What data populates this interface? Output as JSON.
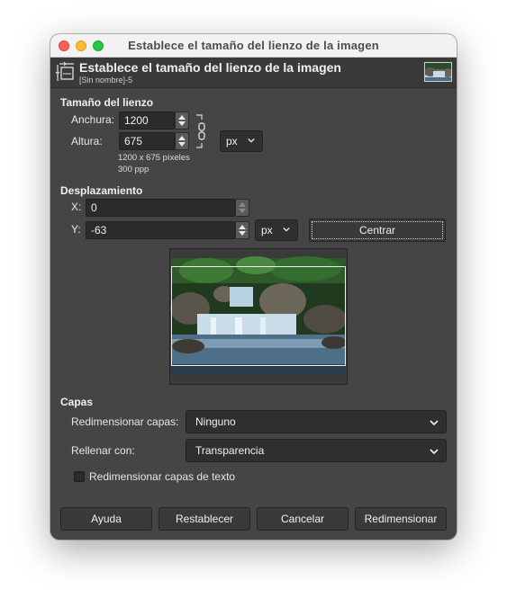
{
  "window": {
    "title": "Establece el tamaño del lienzo de la imagen"
  },
  "header": {
    "title": "Establece el tamaño del lienzo de la imagen",
    "subtitle": "[Sin nombre]-5",
    "icon": "canvas-size-icon"
  },
  "canvas_size": {
    "section_title": "Tamaño del lienzo",
    "width_label": "Anchura:",
    "width_value": "1200",
    "height_label": "Altura:",
    "height_value": "675",
    "unit": "px",
    "size_info": "1200 x 675 píxeles",
    "resolution_info": "300 ppp",
    "chain_icon": "chain-link-icon"
  },
  "offset": {
    "section_title": "Desplazamiento",
    "x_label": "X:",
    "x_value": "0",
    "y_label": "Y:",
    "y_value": "-63",
    "unit": "px",
    "center_button": "Centrar"
  },
  "layers": {
    "section_title": "Capas",
    "resize_label": "Redimensionar capas:",
    "resize_value": "Ninguno",
    "fill_label": "Rellenar con:",
    "fill_value": "Transparencia",
    "resize_text_layers_label": "Redimensionar capas de texto",
    "resize_text_layers_checked": false
  },
  "buttons": {
    "help": "Ayuda",
    "reset": "Restablecer",
    "cancel": "Cancelar",
    "resize": "Redimensionar"
  },
  "colors": {
    "dialog_bg": "#454545",
    "close": "#fe5f57",
    "minimize": "#febc2e",
    "zoom": "#28c840"
  }
}
